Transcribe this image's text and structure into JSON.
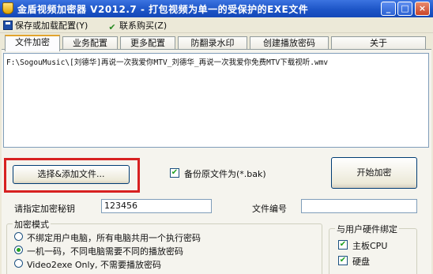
{
  "window": {
    "title": "金盾视频加密器 V2012.7 - 打包视频为单一的受保护的EXE文件",
    "minimize_glyph": "_",
    "maximize_glyph": "□",
    "close_glyph": "×",
    "icons": {
      "app": "shield-app-icon",
      "save": "floppy-disk-icon",
      "shop": "cart-icon"
    }
  },
  "menu": {
    "save_load_config": "保存或加载配置(Y)",
    "contact_purchase": "联系购买(Z)"
  },
  "tabs": [
    {
      "label": "文件加密",
      "active": true
    },
    {
      "label": "业务配置",
      "active": false
    },
    {
      "label": "更多配置",
      "active": false
    },
    {
      "label": "防翻录水印",
      "active": false
    },
    {
      "label": "创建播放密码",
      "active": false
    },
    {
      "label": "关于",
      "active": false
    }
  ],
  "file_list": {
    "items": [
      "F:\\SogouMusic\\[刘德华]再说一次我爱你MTV_刘德华_再说一次我爱你免费MTV下载视听.wmv"
    ]
  },
  "actions": {
    "select_add_file": "选择&添加文件...",
    "backup_original_label": "备份原文件为(*.bak)",
    "backup_original_checked": true,
    "start_encrypt": "开始加密"
  },
  "fields": {
    "key_label": "请指定加密秘钥",
    "key_value": "123456",
    "file_number_label": "文件编号",
    "file_number_value": ""
  },
  "encrypt_mode": {
    "title": "加密模式",
    "options": [
      {
        "label": "不绑定用户电脑，所有电脑共用一个执行密码",
        "checked": false
      },
      {
        "label": "一机一码，不同电脑需要不同的播放密码",
        "checked": true
      },
      {
        "label": "Video2exe Only, 不需要播放密码",
        "checked": false
      }
    ]
  },
  "hardware_binding": {
    "title": "与用户硬件绑定",
    "options": [
      {
        "label": "主板CPU",
        "checked": true
      },
      {
        "label": "硬盘",
        "checked": true
      }
    ]
  }
}
